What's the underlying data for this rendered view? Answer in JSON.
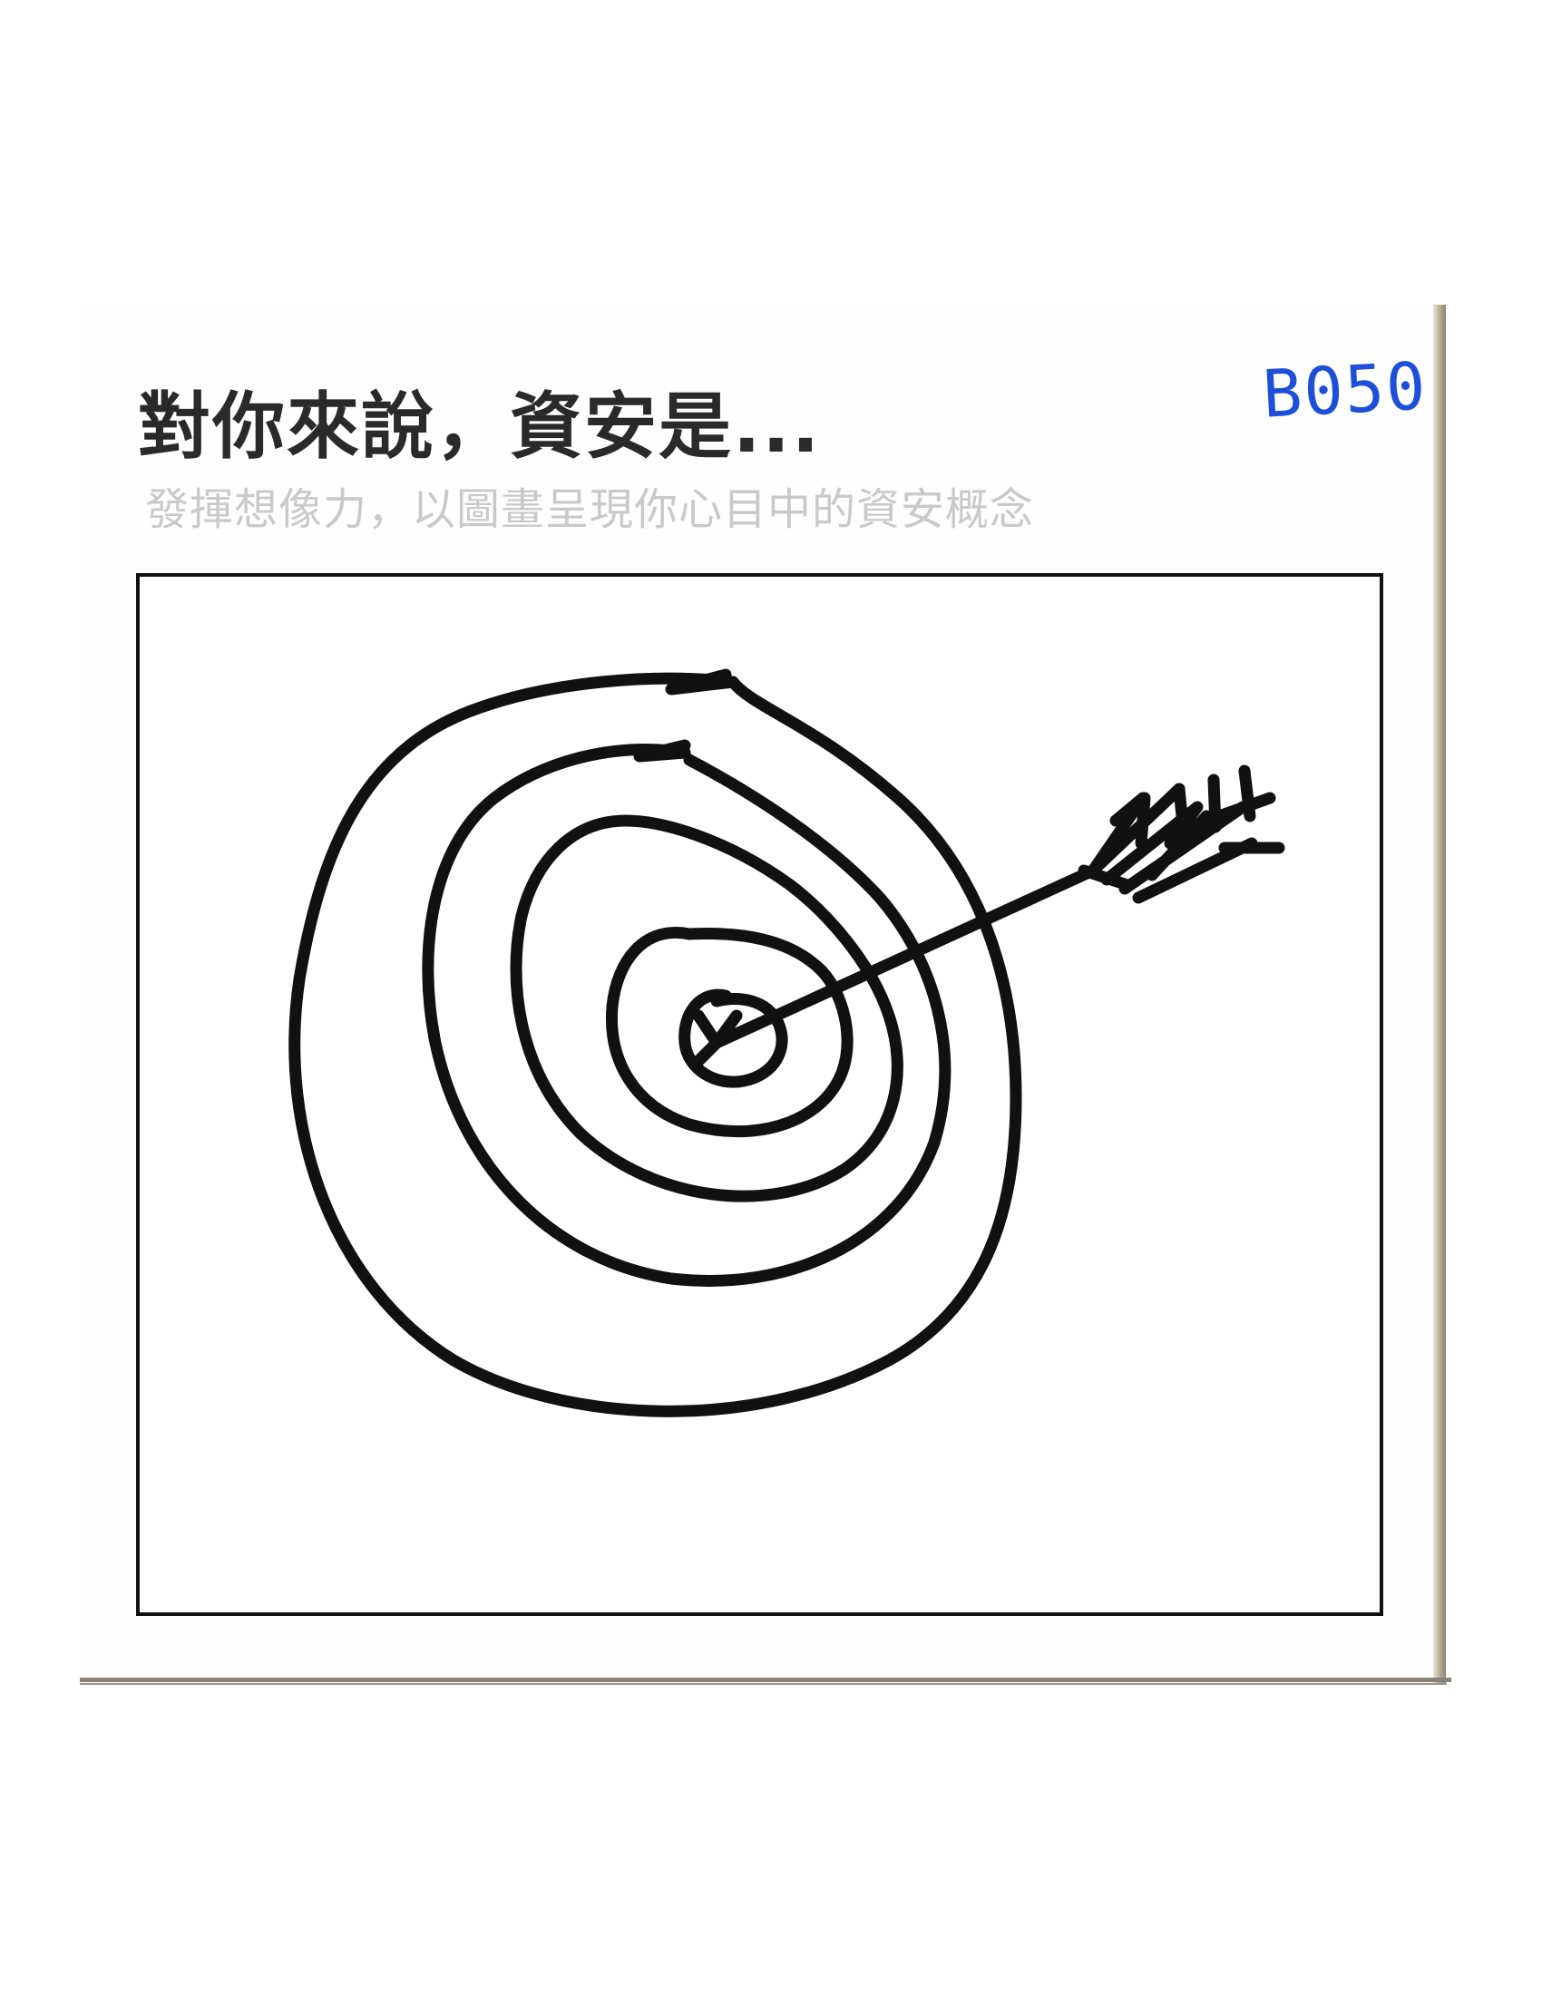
{
  "card": {
    "title": "對你來說，資安是...",
    "subtitle": "發揮想像力，以圖畫呈現你心目中的資安概念",
    "code": "B050"
  },
  "drawing": {
    "subject": "target-with-arrow",
    "ink_color": "#111111",
    "code_color": "#1e4fd8"
  }
}
